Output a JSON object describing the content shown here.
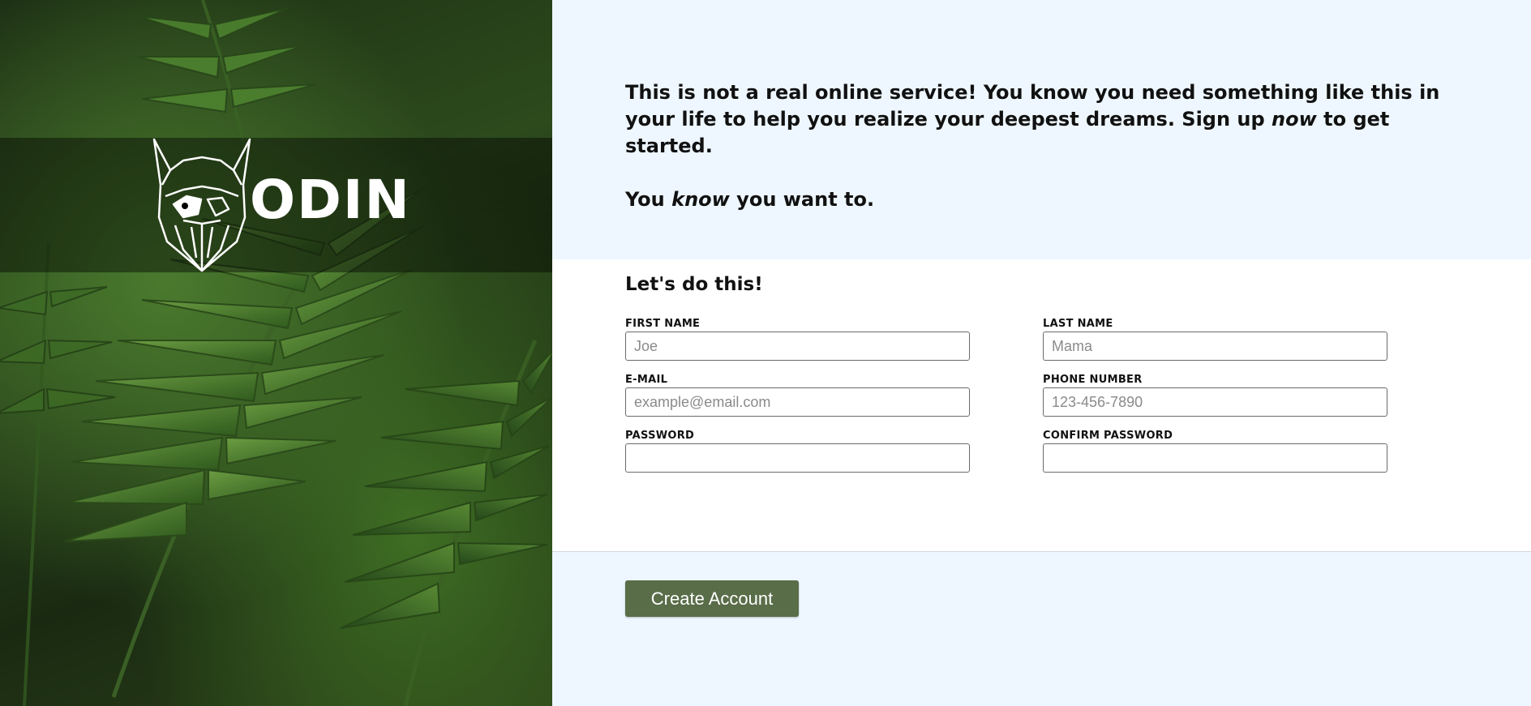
{
  "brand": {
    "logo_text": "ODIN",
    "logo_icon": "viking-helmet-icon",
    "background_image": "fern-leaves"
  },
  "intro": {
    "line1_before": "This is not a real online service! You know you need something like this in your life to help you realize your deepest dreams. Sign up ",
    "line1_emphasis": "now",
    "line1_after": " to get started.",
    "line2_before": "You ",
    "line2_emphasis": "know",
    "line2_after": " you want to."
  },
  "form": {
    "title": "Let's do this!",
    "fields": {
      "first_name": {
        "label": "FIRST NAME",
        "placeholder": "Joe",
        "value": ""
      },
      "last_name": {
        "label": "LAST NAME",
        "placeholder": "Mama",
        "value": ""
      },
      "email": {
        "label": "E-MAIL",
        "placeholder": "example@email.com",
        "value": ""
      },
      "phone": {
        "label": "PHONE NUMBER",
        "placeholder": "123-456-7890",
        "value": ""
      },
      "password": {
        "label": "PASSWORD",
        "placeholder": "",
        "value": ""
      },
      "confirm_password": {
        "label": "CONFIRM PASSWORD",
        "placeholder": "",
        "value": ""
      }
    }
  },
  "actions": {
    "submit_label": "Create Account"
  },
  "colors": {
    "page_background": "#eef7ff",
    "form_background": "#ffffff",
    "button": "#596d48",
    "button_text": "#ffffff"
  }
}
